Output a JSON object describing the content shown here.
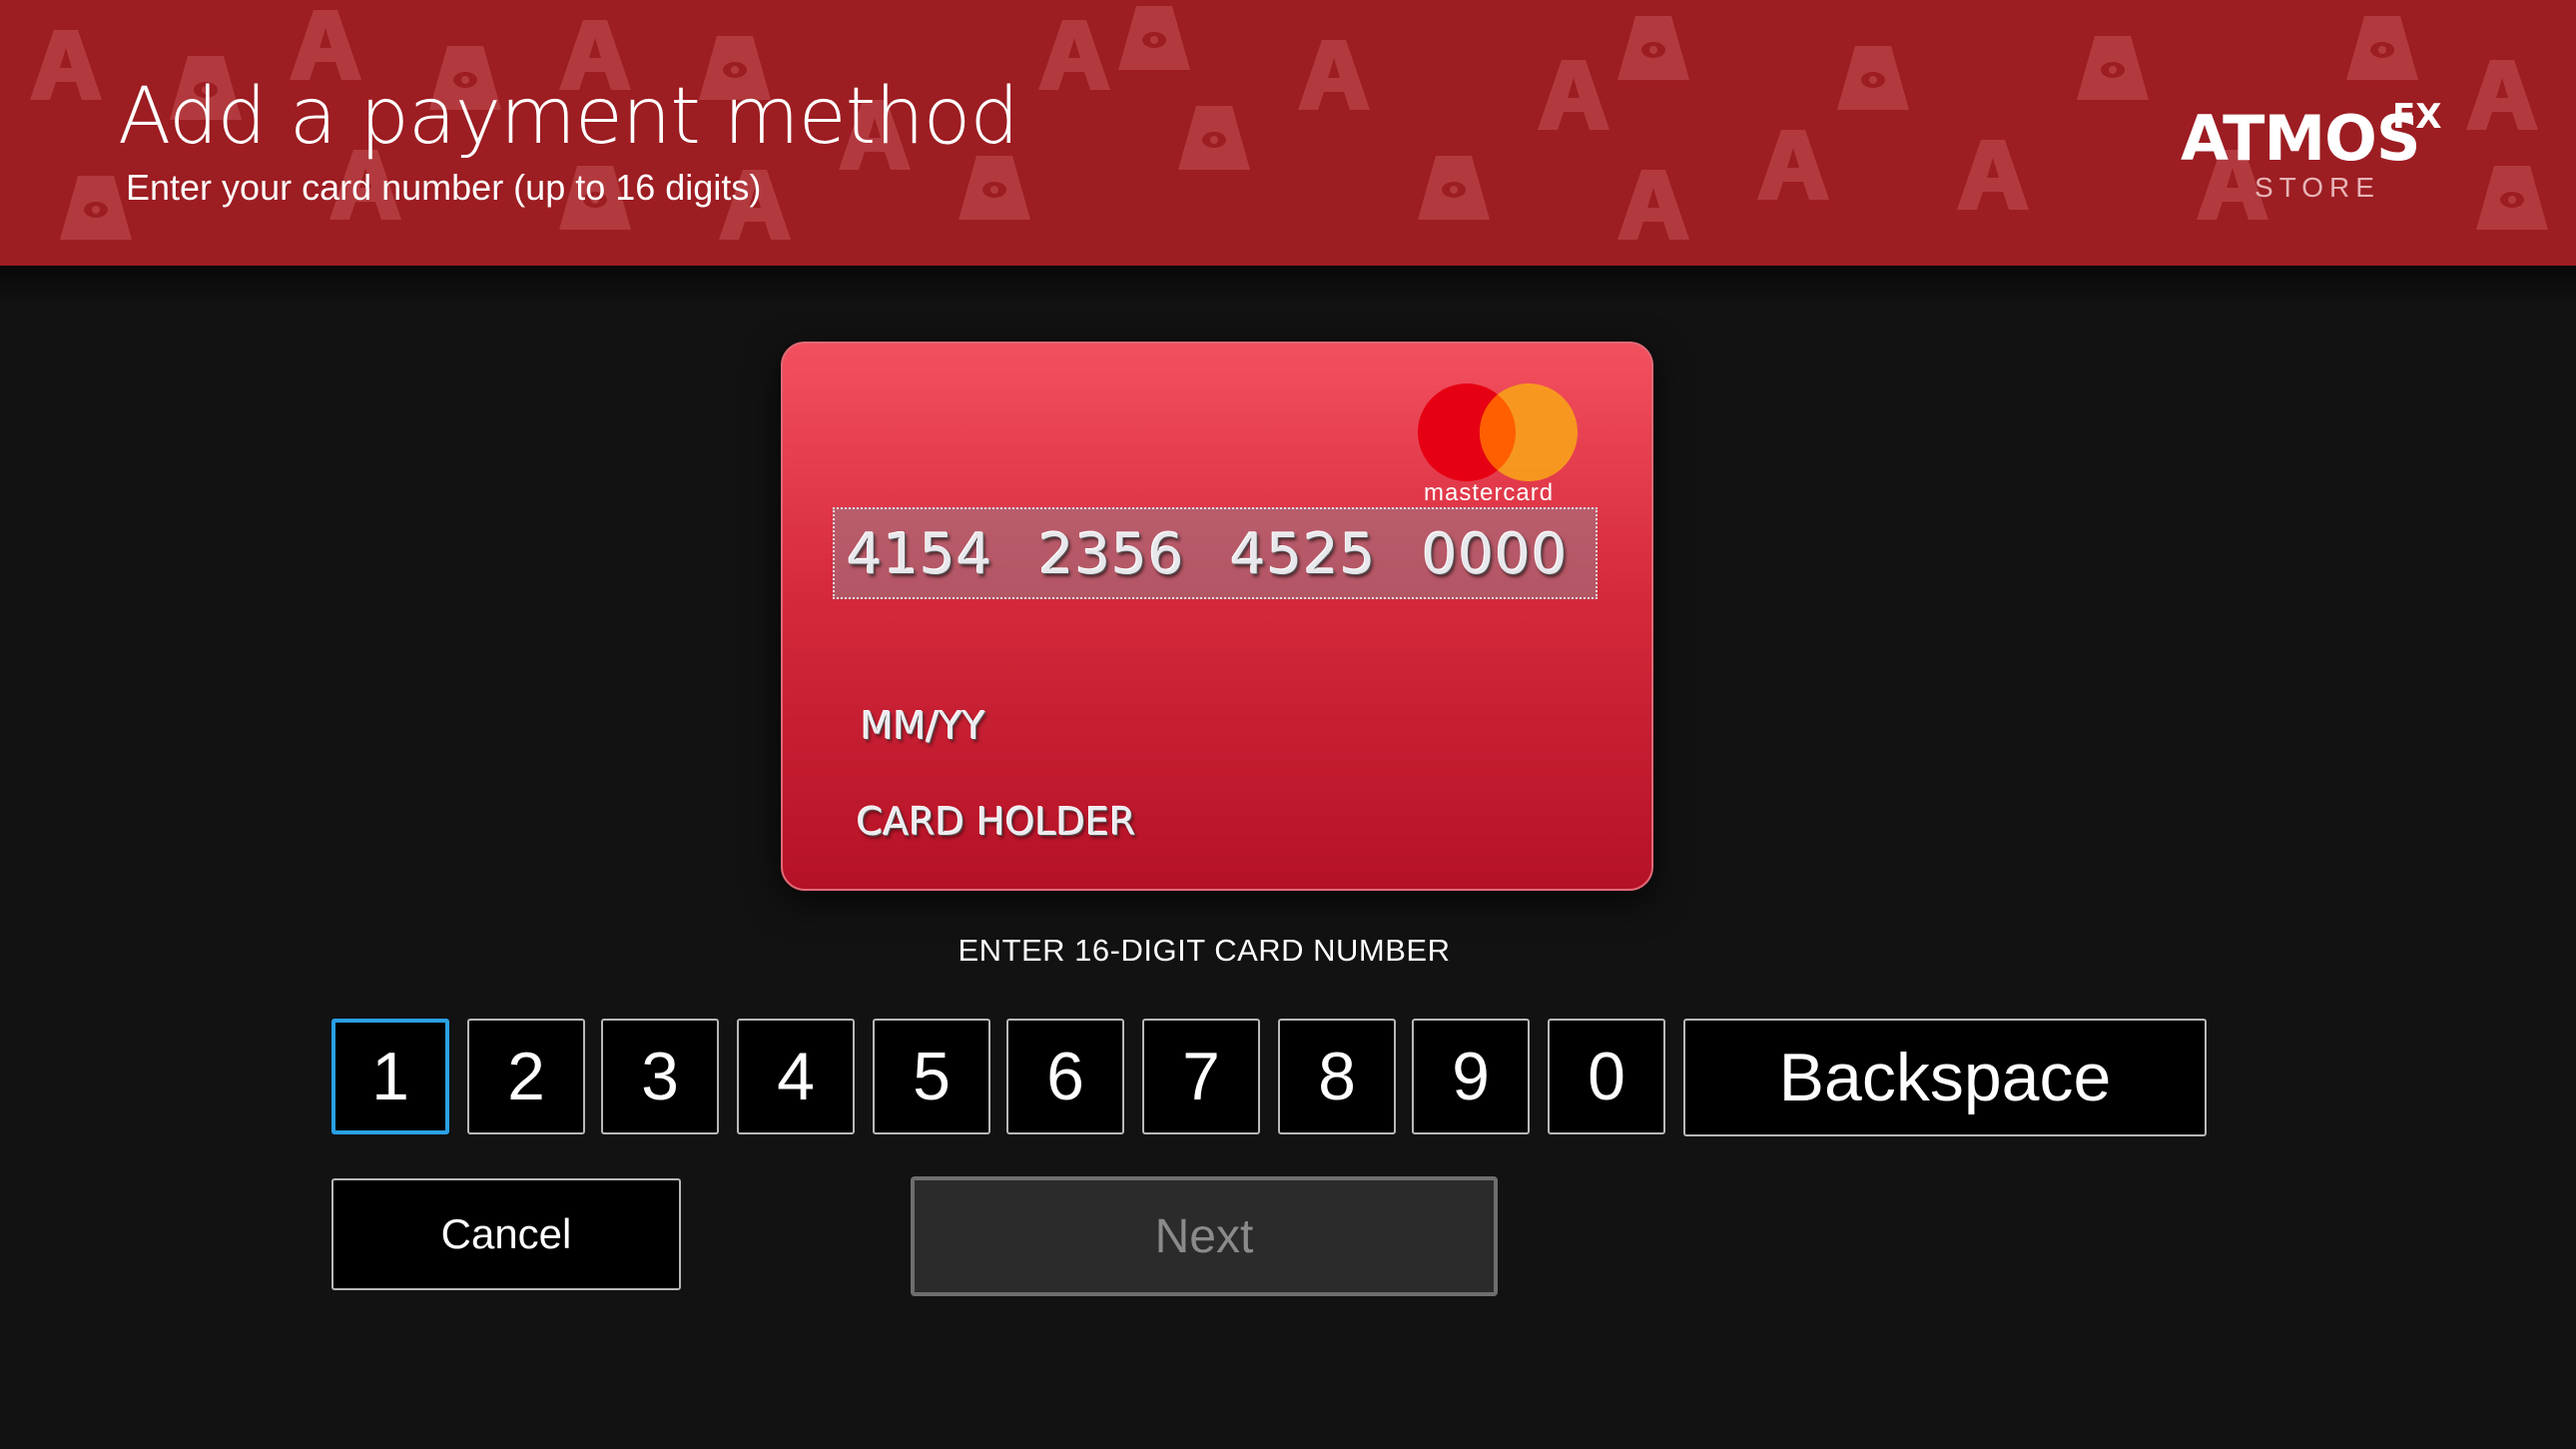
{
  "header": {
    "title": "Add a payment method",
    "subtitle": "Enter your card number (up to 16 digits)",
    "logo": {
      "word": "ATMOS",
      "superscript": "FX",
      "tagline": "STORE"
    },
    "background_color": "#9c1d22"
  },
  "card": {
    "brand": "mastercard",
    "number_groups": [
      "4154",
      "2356",
      "4525",
      "0000"
    ],
    "expiry_placeholder": "MM/YY",
    "holder_placeholder": "CARD HOLDER",
    "colors": {
      "gradient_top": "#f3505f",
      "gradient_bottom": "#b51126"
    }
  },
  "instruction": "ENTER 16-DIGIT CARD NUMBER",
  "keypad": {
    "keys": [
      "1",
      "2",
      "3",
      "4",
      "5",
      "6",
      "7",
      "8",
      "9",
      "0"
    ],
    "backspace_label": "Backspace",
    "focused_key": "1",
    "focus_color": "#2aa0e4"
  },
  "actions": {
    "cancel_label": "Cancel",
    "next_label": "Next",
    "next_state": "disabled"
  }
}
